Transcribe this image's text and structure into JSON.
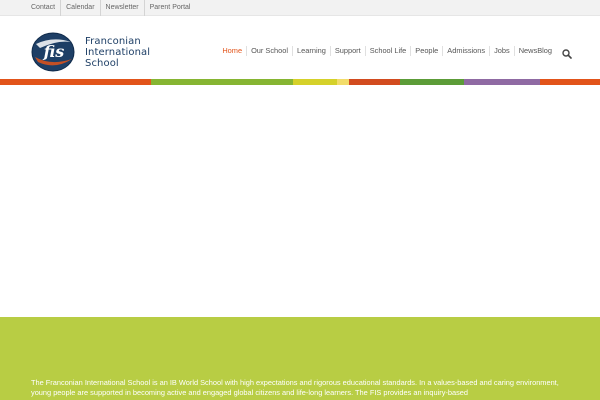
{
  "topbar": {
    "links": [
      "Contact",
      "Calendar",
      "Newsletter",
      "Parent Portal"
    ]
  },
  "logo": {
    "line1": "Franconian",
    "line2": "International",
    "line3": "School",
    "mark_text": "fis"
  },
  "nav": {
    "items": [
      "Home",
      "Our School",
      "Learning",
      "Support",
      "School Life",
      "People",
      "Admissions",
      "Jobs",
      "NewsBlog"
    ],
    "active": "Home",
    "search_icon": "search-icon"
  },
  "colors": {
    "accent": "#e2541a",
    "brand_navy": "#1e3f66",
    "footer_green": "#b8cd44",
    "stripe": [
      "#e2541a",
      "#86b532",
      "#d5d12a",
      "#f2dc6a",
      "#d24b1f",
      "#5c9c38",
      "#8f6aa3",
      "#e2541a"
    ]
  },
  "intro": {
    "text": "The Franconian International School is an IB World School with high expectations and rigorous educational standards. In a values-based and caring environment, young people are supported in becoming active and engaged global citizens and life-long learners. The FIS provides an inquiry-based"
  }
}
